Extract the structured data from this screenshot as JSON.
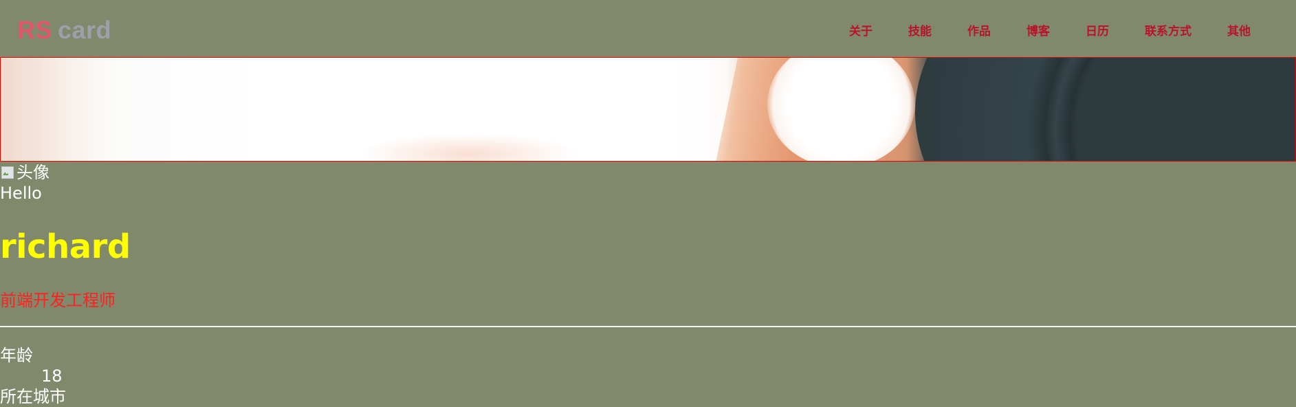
{
  "header": {
    "logo": {
      "part1": "RS",
      "part2": "card"
    },
    "nav": [
      "关于",
      "技能",
      "作品",
      "博客",
      "日历",
      "联系方式",
      "其他"
    ]
  },
  "profile": {
    "avatar_alt": "头像",
    "greeting": "Hello",
    "name": "richard",
    "job_title": "前端开发工程师"
  },
  "info": [
    {
      "label": "年龄",
      "value": "18"
    },
    {
      "label": "所在城市"
    }
  ],
  "colors": {
    "background": "#80896b",
    "nav_text": "#b8132a",
    "name": "#ffff00",
    "job_title": "#ff2020",
    "banner_border": "#e00000"
  }
}
